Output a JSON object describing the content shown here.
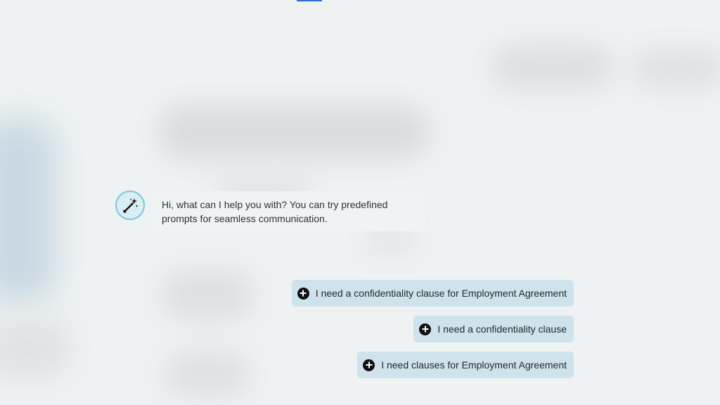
{
  "colors": {
    "background": "#eef2f2",
    "chip": "#cfe3ec",
    "bubble": "#f1f2f3",
    "avatar_ring": "#7fc6dc",
    "accent": "#2f6fcf"
  },
  "assistant": {
    "avatar_icon": "magic-wand-icon",
    "message": "Hi, what can I help you with? You can try predefined prompts for seamless communication."
  },
  "suggestions": [
    {
      "icon": "plus-circle-icon",
      "label": "I need a confidentiality clause for Employment Agreement"
    },
    {
      "icon": "plus-circle-icon",
      "label": "I need a confidentiality clause"
    },
    {
      "icon": "plus-circle-icon",
      "label": "I need clauses for Employment Agreement"
    }
  ]
}
